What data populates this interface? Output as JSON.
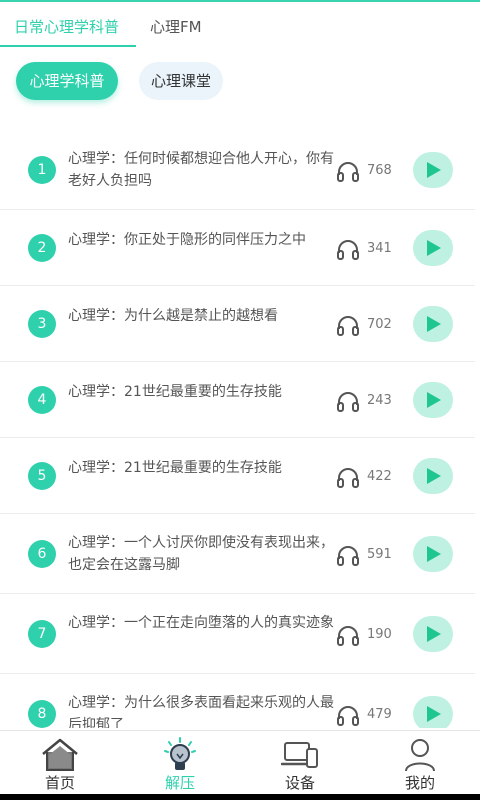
{
  "tabs": [
    {
      "label": "日常心理学科普",
      "active": true
    },
    {
      "label": "心理FM",
      "active": false
    }
  ],
  "chips": [
    {
      "label": "心理学科普",
      "active": true
    },
    {
      "label": "心理课堂",
      "active": false
    }
  ],
  "items": [
    {
      "num": "1",
      "title": "心理学：任何时候都想迎合他人开心，你有老好人负担吗",
      "count": "768"
    },
    {
      "num": "2",
      "title": "心理学：你正处于隐形的同伴压力之中",
      "count": "341"
    },
    {
      "num": "3",
      "title": "心理学：为什么越是禁止的越想看",
      "count": "702"
    },
    {
      "num": "4",
      "title": "心理学：21世纪最重要的生存技能",
      "count": "243"
    },
    {
      "num": "5",
      "title": "心理学：21世纪最重要的生存技能",
      "count": "422"
    },
    {
      "num": "6",
      "title": "心理学：一个人讨厌你即使没有表现出来，也定会在这露马脚",
      "count": "591"
    },
    {
      "num": "7",
      "title": "心理学：一个正在走向堕落的人的真实迹象",
      "count": "190"
    },
    {
      "num": "8",
      "title": "心理学：为什么很多表面看起来乐观的人最后抑郁了",
      "count": "479"
    }
  ],
  "nav": [
    {
      "label": "首页",
      "icon": "home-icon",
      "active": false
    },
    {
      "label": "解压",
      "icon": "lightbulb-icon",
      "active": true
    },
    {
      "label": "设备",
      "icon": "devices-icon",
      "active": false
    },
    {
      "label": "我的",
      "icon": "user-icon",
      "active": false
    }
  ],
  "colors": {
    "accent": "#2fd1ad",
    "play_bg": "#bff1e2",
    "play_icon": "#20c68f"
  }
}
